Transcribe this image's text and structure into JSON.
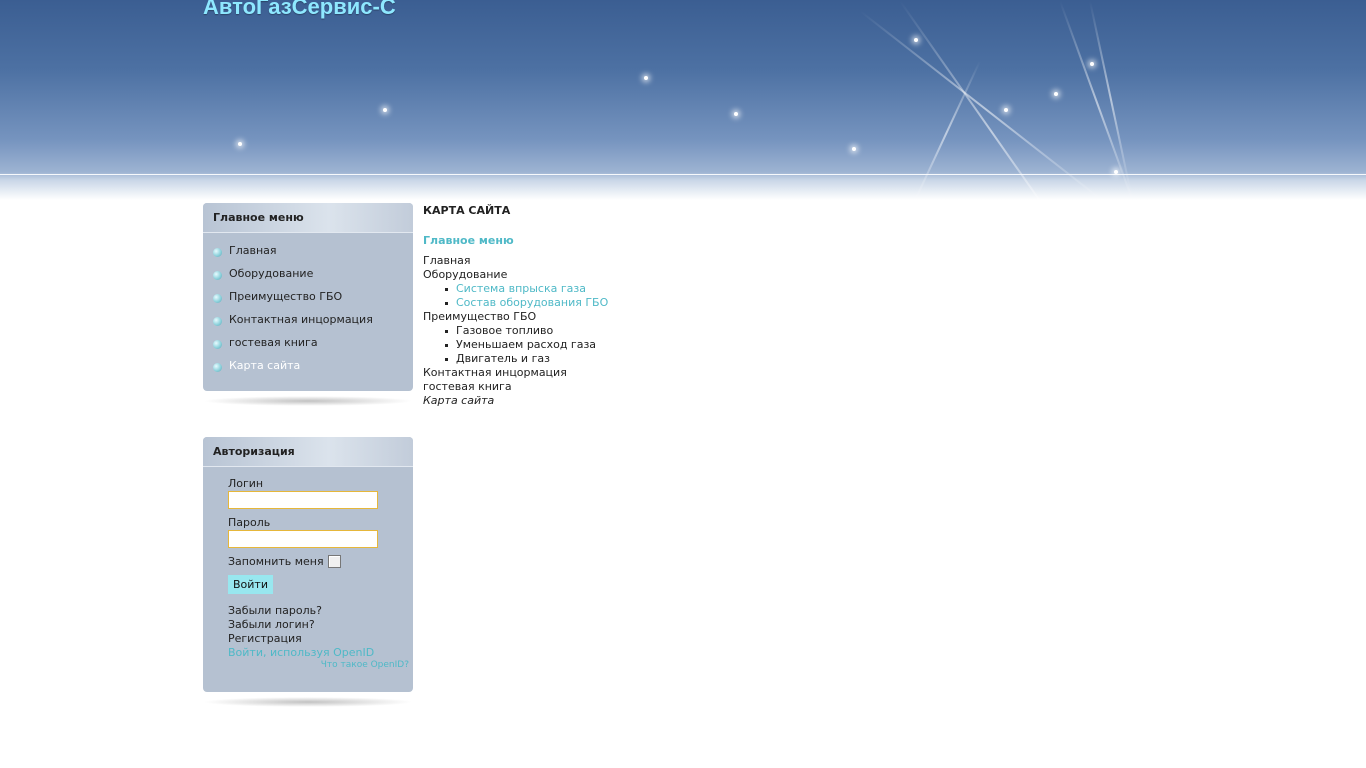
{
  "site": {
    "title": "АвтоГазСервис-С"
  },
  "menu": {
    "title": "Главное меню",
    "items": [
      {
        "label": "Главная"
      },
      {
        "label": "Оборудование"
      },
      {
        "label": "Преимущество ГБО"
      },
      {
        "label": "Контактная инцормация"
      },
      {
        "label": "гостевая книга"
      },
      {
        "label": "Карта сайта"
      }
    ]
  },
  "auth": {
    "title": "Авторизация",
    "login_label": "Логин",
    "login_value": "",
    "password_label": "Пароль",
    "password_value": "",
    "remember_label": "Запомнить меня",
    "submit_label": "Войти",
    "forgot_password": "Забыли пароль?",
    "forgot_login": "Забыли логин?",
    "register": "Регистрация",
    "openid_login": "Войти, используя OpenID",
    "openid_help": "Что такое OpenID?"
  },
  "sitemap": {
    "title": "КАРТА САЙТА",
    "section": "Главное меню",
    "items": [
      {
        "label": "Главная"
      },
      {
        "label": "Оборудование",
        "children": [
          "Система впрыска газа",
          "Состав оборудования ГБО"
        ]
      },
      {
        "label": "Преимущество ГБО",
        "children": [
          "Газовое топливо",
          "Уменьшаем расход газа",
          "Двигатель и газ"
        ]
      },
      {
        "label": "Контактная инцормация"
      },
      {
        "label": "гостевая книга"
      },
      {
        "label": "Карта сайта"
      }
    ]
  },
  "colors": {
    "accent": "#4fb9c7",
    "title": "#8ee8ff",
    "module_bg": "#b5c1d1",
    "input_border": "#e6b73a",
    "button_bg": "#98e7ef"
  }
}
